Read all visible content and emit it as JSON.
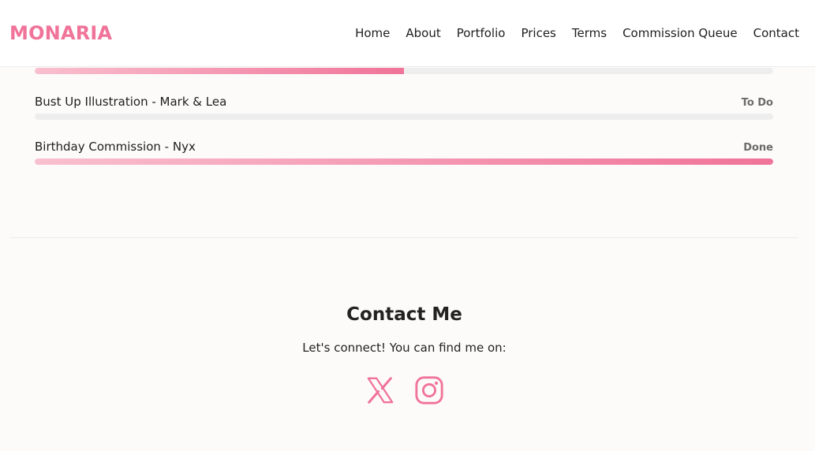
{
  "brand": {
    "name": "MONARIA",
    "color": "#f07399"
  },
  "nav": {
    "items": [
      {
        "label": "Home"
      },
      {
        "label": "About"
      },
      {
        "label": "Portfolio"
      },
      {
        "label": "Prices"
      },
      {
        "label": "Terms"
      },
      {
        "label": "Commission Queue"
      },
      {
        "label": "Contact"
      }
    ]
  },
  "queue": {
    "partial_item": {
      "progress": 0.5
    },
    "items": [
      {
        "title": "Bust Up Illustration - Mark & Lea",
        "status": "To Do",
        "progress": 0
      },
      {
        "title": "Birthday Commission - Nyx",
        "status": "Done",
        "progress": 1
      }
    ]
  },
  "contact": {
    "title": "Contact Me",
    "subtitle": "Let's connect! You can find me on:",
    "socials": [
      {
        "icon": "x-twitter-icon"
      },
      {
        "icon": "instagram-icon"
      }
    ]
  },
  "colors": {
    "accent": "#f07399",
    "accent_light": "#f9c0cf",
    "track": "#eeeeee"
  }
}
